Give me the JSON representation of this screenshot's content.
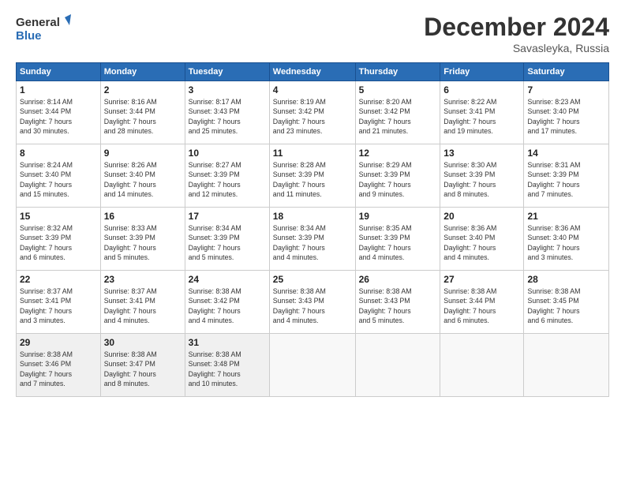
{
  "logo": {
    "line1": "General",
    "line2": "Blue"
  },
  "title": "December 2024",
  "subtitle": "Savasleyka, Russia",
  "days_header": [
    "Sunday",
    "Monday",
    "Tuesday",
    "Wednesday",
    "Thursday",
    "Friday",
    "Saturday"
  ],
  "weeks": [
    [
      {
        "day": "1",
        "info": "Sunrise: 8:14 AM\nSunset: 3:44 PM\nDaylight: 7 hours\nand 30 minutes."
      },
      {
        "day": "2",
        "info": "Sunrise: 8:16 AM\nSunset: 3:44 PM\nDaylight: 7 hours\nand 28 minutes."
      },
      {
        "day": "3",
        "info": "Sunrise: 8:17 AM\nSunset: 3:43 PM\nDaylight: 7 hours\nand 25 minutes."
      },
      {
        "day": "4",
        "info": "Sunrise: 8:19 AM\nSunset: 3:42 PM\nDaylight: 7 hours\nand 23 minutes."
      },
      {
        "day": "5",
        "info": "Sunrise: 8:20 AM\nSunset: 3:42 PM\nDaylight: 7 hours\nand 21 minutes."
      },
      {
        "day": "6",
        "info": "Sunrise: 8:22 AM\nSunset: 3:41 PM\nDaylight: 7 hours\nand 19 minutes."
      },
      {
        "day": "7",
        "info": "Sunrise: 8:23 AM\nSunset: 3:40 PM\nDaylight: 7 hours\nand 17 minutes."
      }
    ],
    [
      {
        "day": "8",
        "info": "Sunrise: 8:24 AM\nSunset: 3:40 PM\nDaylight: 7 hours\nand 15 minutes."
      },
      {
        "day": "9",
        "info": "Sunrise: 8:26 AM\nSunset: 3:40 PM\nDaylight: 7 hours\nand 14 minutes."
      },
      {
        "day": "10",
        "info": "Sunrise: 8:27 AM\nSunset: 3:39 PM\nDaylight: 7 hours\nand 12 minutes."
      },
      {
        "day": "11",
        "info": "Sunrise: 8:28 AM\nSunset: 3:39 PM\nDaylight: 7 hours\nand 11 minutes."
      },
      {
        "day": "12",
        "info": "Sunrise: 8:29 AM\nSunset: 3:39 PM\nDaylight: 7 hours\nand 9 minutes."
      },
      {
        "day": "13",
        "info": "Sunrise: 8:30 AM\nSunset: 3:39 PM\nDaylight: 7 hours\nand 8 minutes."
      },
      {
        "day": "14",
        "info": "Sunrise: 8:31 AM\nSunset: 3:39 PM\nDaylight: 7 hours\nand 7 minutes."
      }
    ],
    [
      {
        "day": "15",
        "info": "Sunrise: 8:32 AM\nSunset: 3:39 PM\nDaylight: 7 hours\nand 6 minutes."
      },
      {
        "day": "16",
        "info": "Sunrise: 8:33 AM\nSunset: 3:39 PM\nDaylight: 7 hours\nand 5 minutes."
      },
      {
        "day": "17",
        "info": "Sunrise: 8:34 AM\nSunset: 3:39 PM\nDaylight: 7 hours\nand 5 minutes."
      },
      {
        "day": "18",
        "info": "Sunrise: 8:34 AM\nSunset: 3:39 PM\nDaylight: 7 hours\nand 4 minutes."
      },
      {
        "day": "19",
        "info": "Sunrise: 8:35 AM\nSunset: 3:39 PM\nDaylight: 7 hours\nand 4 minutes."
      },
      {
        "day": "20",
        "info": "Sunrise: 8:36 AM\nSunset: 3:40 PM\nDaylight: 7 hours\nand 4 minutes."
      },
      {
        "day": "21",
        "info": "Sunrise: 8:36 AM\nSunset: 3:40 PM\nDaylight: 7 hours\nand 3 minutes."
      }
    ],
    [
      {
        "day": "22",
        "info": "Sunrise: 8:37 AM\nSunset: 3:41 PM\nDaylight: 7 hours\nand 3 minutes."
      },
      {
        "day": "23",
        "info": "Sunrise: 8:37 AM\nSunset: 3:41 PM\nDaylight: 7 hours\nand 4 minutes."
      },
      {
        "day": "24",
        "info": "Sunrise: 8:38 AM\nSunset: 3:42 PM\nDaylight: 7 hours\nand 4 minutes."
      },
      {
        "day": "25",
        "info": "Sunrise: 8:38 AM\nSunset: 3:43 PM\nDaylight: 7 hours\nand 4 minutes."
      },
      {
        "day": "26",
        "info": "Sunrise: 8:38 AM\nSunset: 3:43 PM\nDaylight: 7 hours\nand 5 minutes."
      },
      {
        "day": "27",
        "info": "Sunrise: 8:38 AM\nSunset: 3:44 PM\nDaylight: 7 hours\nand 6 minutes."
      },
      {
        "day": "28",
        "info": "Sunrise: 8:38 AM\nSunset: 3:45 PM\nDaylight: 7 hours\nand 6 minutes."
      }
    ],
    [
      {
        "day": "29",
        "info": "Sunrise: 8:38 AM\nSunset: 3:46 PM\nDaylight: 7 hours\nand 7 minutes."
      },
      {
        "day": "30",
        "info": "Sunrise: 8:38 AM\nSunset: 3:47 PM\nDaylight: 7 hours\nand 8 minutes."
      },
      {
        "day": "31",
        "info": "Sunrise: 8:38 AM\nSunset: 3:48 PM\nDaylight: 7 hours\nand 10 minutes."
      },
      null,
      null,
      null,
      null
    ]
  ]
}
